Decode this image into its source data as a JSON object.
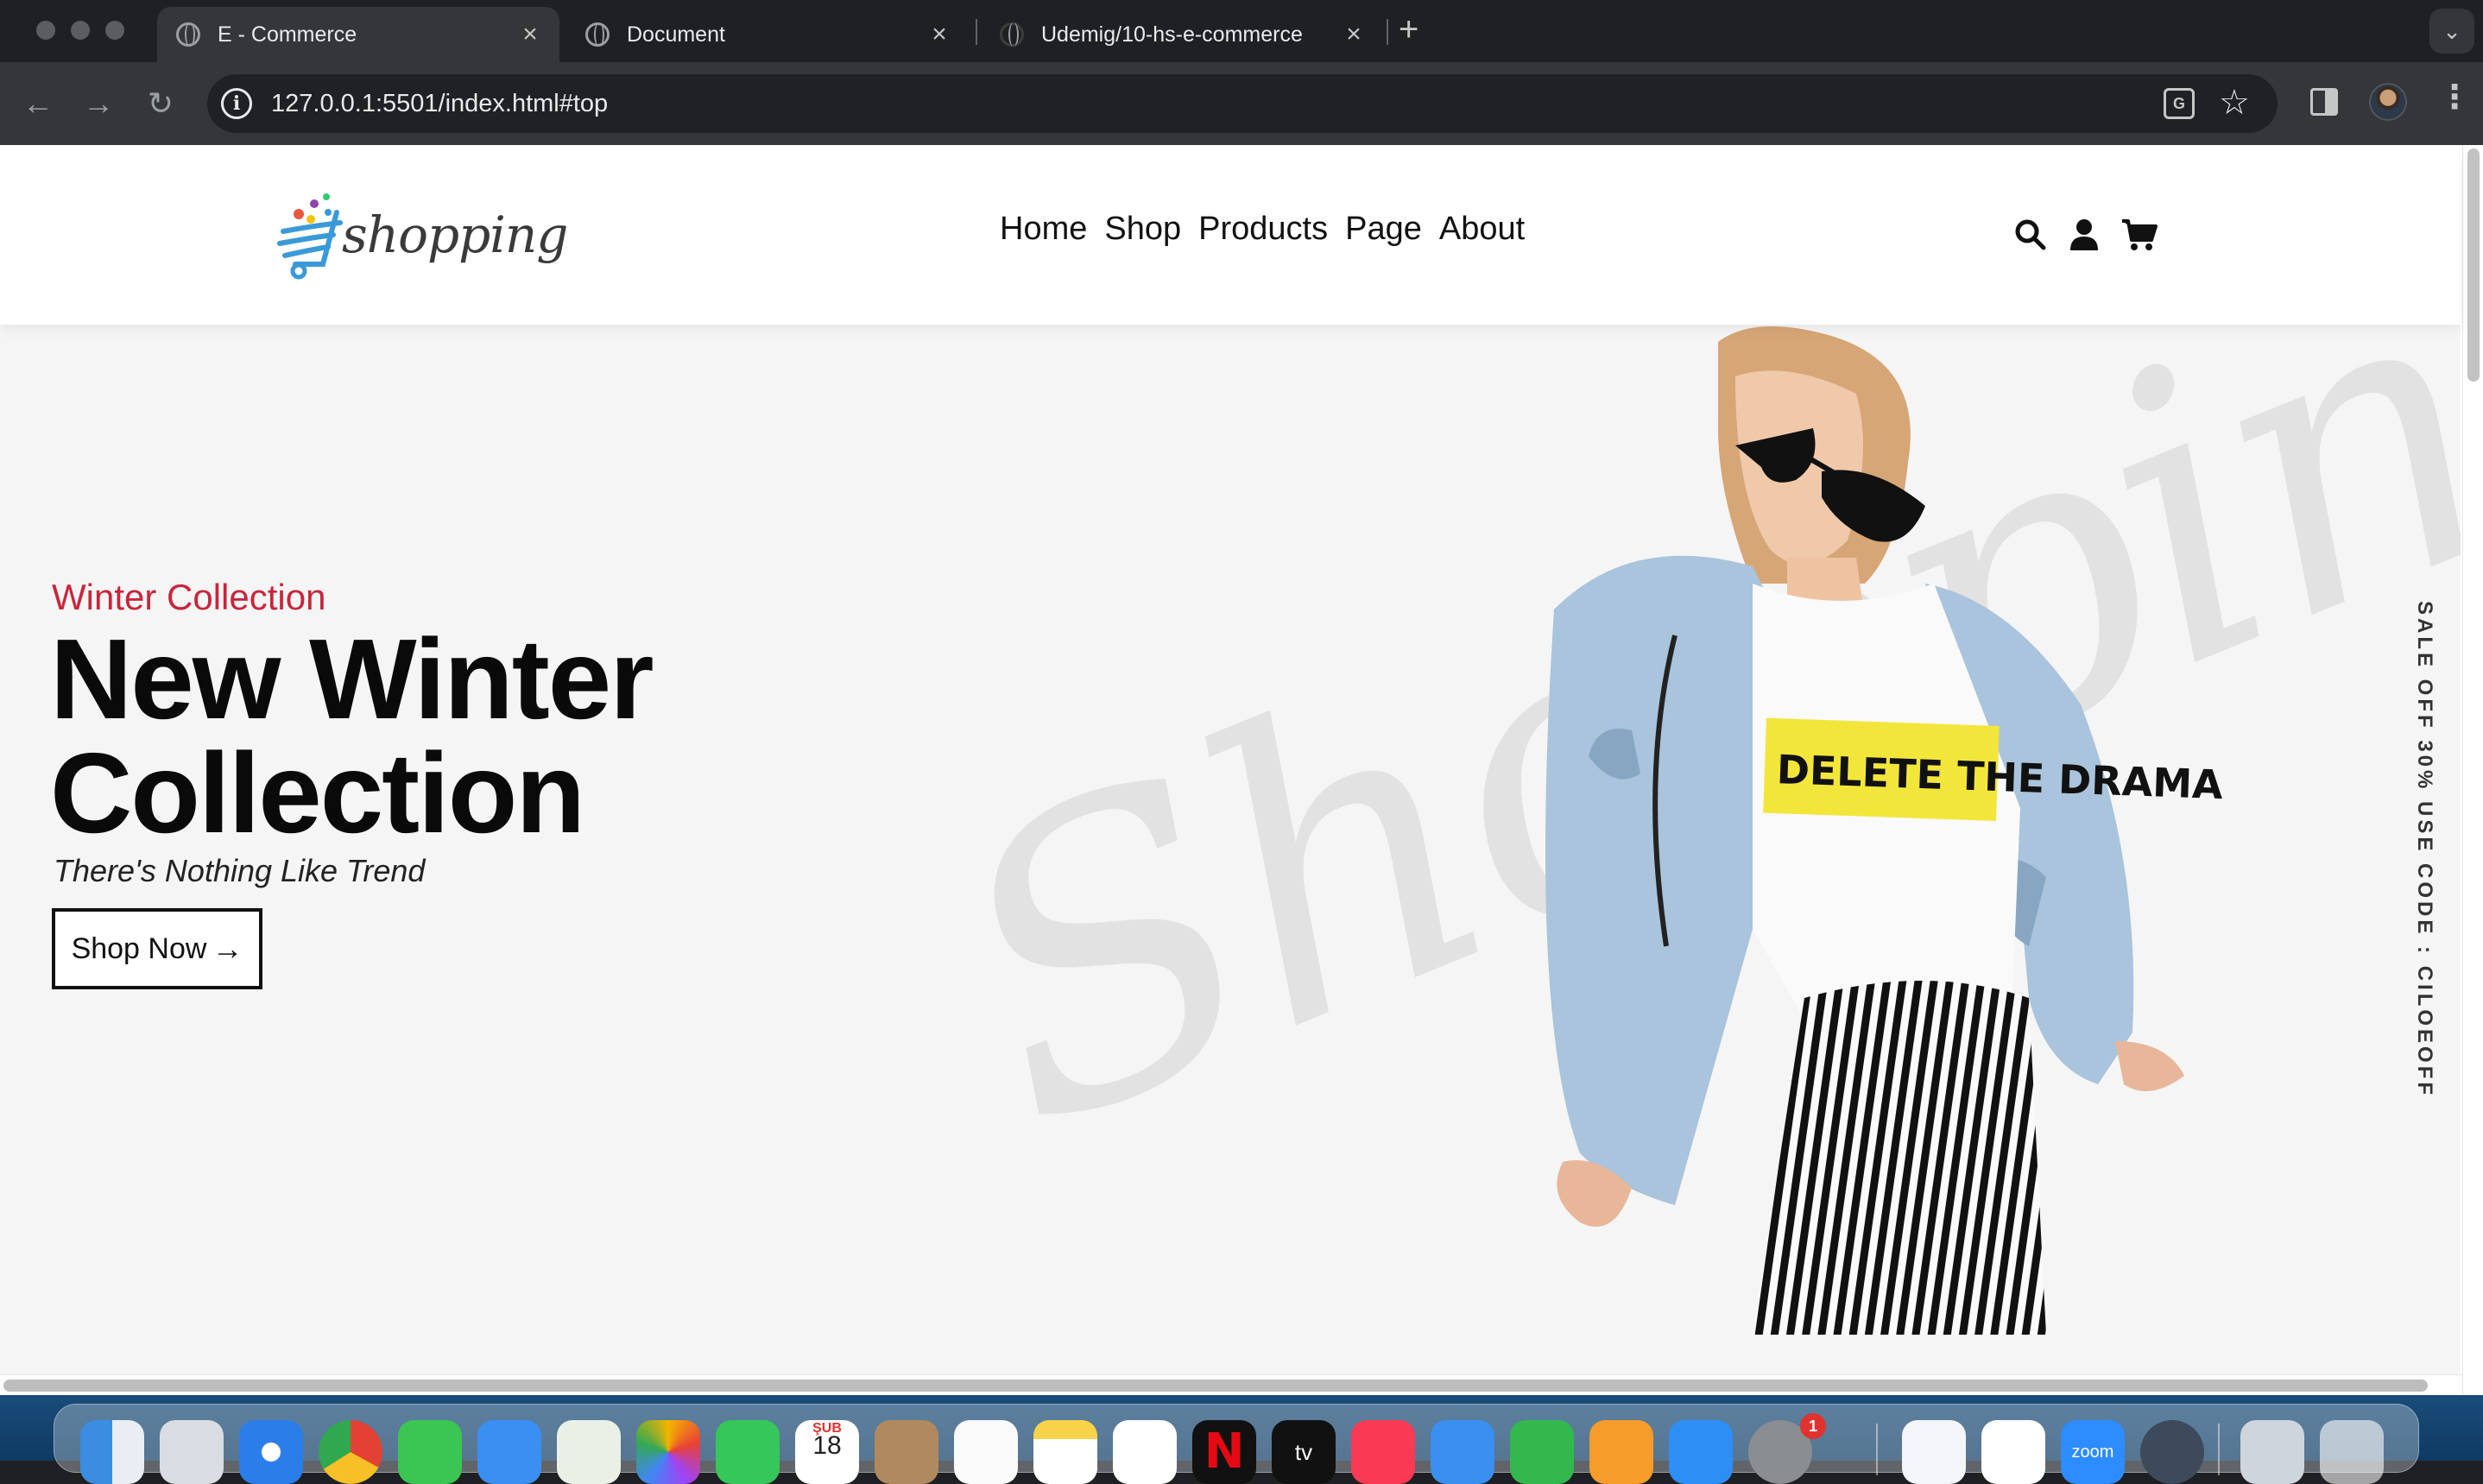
{
  "browser": {
    "tabs": [
      {
        "title": "E - Commerce",
        "close": "×",
        "active": true
      },
      {
        "title": "Document",
        "close": "×",
        "active": false
      },
      {
        "title": "Udemig/10-hs-e-commerce",
        "close": "×",
        "active": false
      }
    ],
    "new_tab": "+",
    "tab_menu": "⌄",
    "back": "←",
    "forward": "→",
    "reload": "↻",
    "url": "127.0.0.1:5501/index.html#top",
    "info_icon": "i",
    "translate_icon": "G",
    "star_icon": "☆",
    "menu_icon": "⋮"
  },
  "site": {
    "logo_text": "shopping",
    "nav": [
      "Home",
      "Shop",
      "Products",
      "Page",
      "About"
    ],
    "icons": [
      "search-icon",
      "user-icon",
      "cart-icon"
    ]
  },
  "hero": {
    "eyebrow": "Winter Collection",
    "title_line1": "New Winter",
    "title_line2": "Collection",
    "subtitle": "There's Nothing Like Trend",
    "cta_label": "Shop Now",
    "cta_arrow": "→",
    "watermark": "Shopping",
    "shirt_text": "DELETE THE DRAMA",
    "vertical_banner": "SALE OFF 30% USE CODE : CILOEOFF"
  },
  "dock": {
    "calendar_month": "ŞUB",
    "calendar_day": "18",
    "settings_badge": "1",
    "zoom_label": "zoom",
    "tv_label": "tv"
  },
  "colors": {
    "accent_red": "#c9253b",
    "chrome_dark": "#1f2023",
    "hero_bg": "#f5f5f5"
  }
}
